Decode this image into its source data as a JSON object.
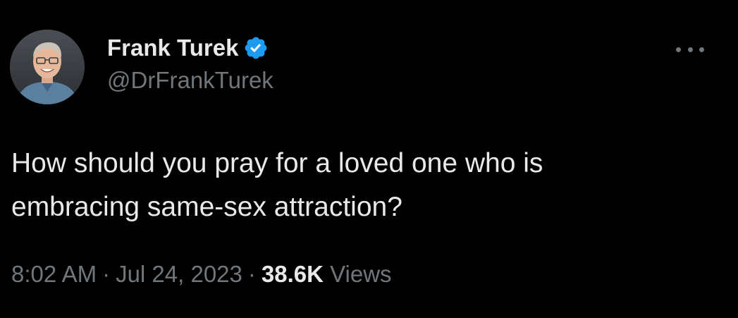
{
  "tweet": {
    "author": {
      "display_name": "Frank Turek",
      "handle": "@DrFrankTurek",
      "verified": true
    },
    "text_line1": "How should you pray for a loved one who is",
    "text_line2": "embracing same-sex attraction?",
    "time": "8:02 AM",
    "separator": "·",
    "date": "Jul 24, 2023",
    "views_count": "38.6K",
    "views_label": "Views"
  },
  "colors": {
    "background": "#000000",
    "primary_text": "#e7e9ea",
    "secondary_text": "#71767b",
    "verified_badge": "#1d9bf0"
  },
  "icons": {
    "more": "more-horizontal-icon",
    "verified": "verified-badge-icon"
  }
}
